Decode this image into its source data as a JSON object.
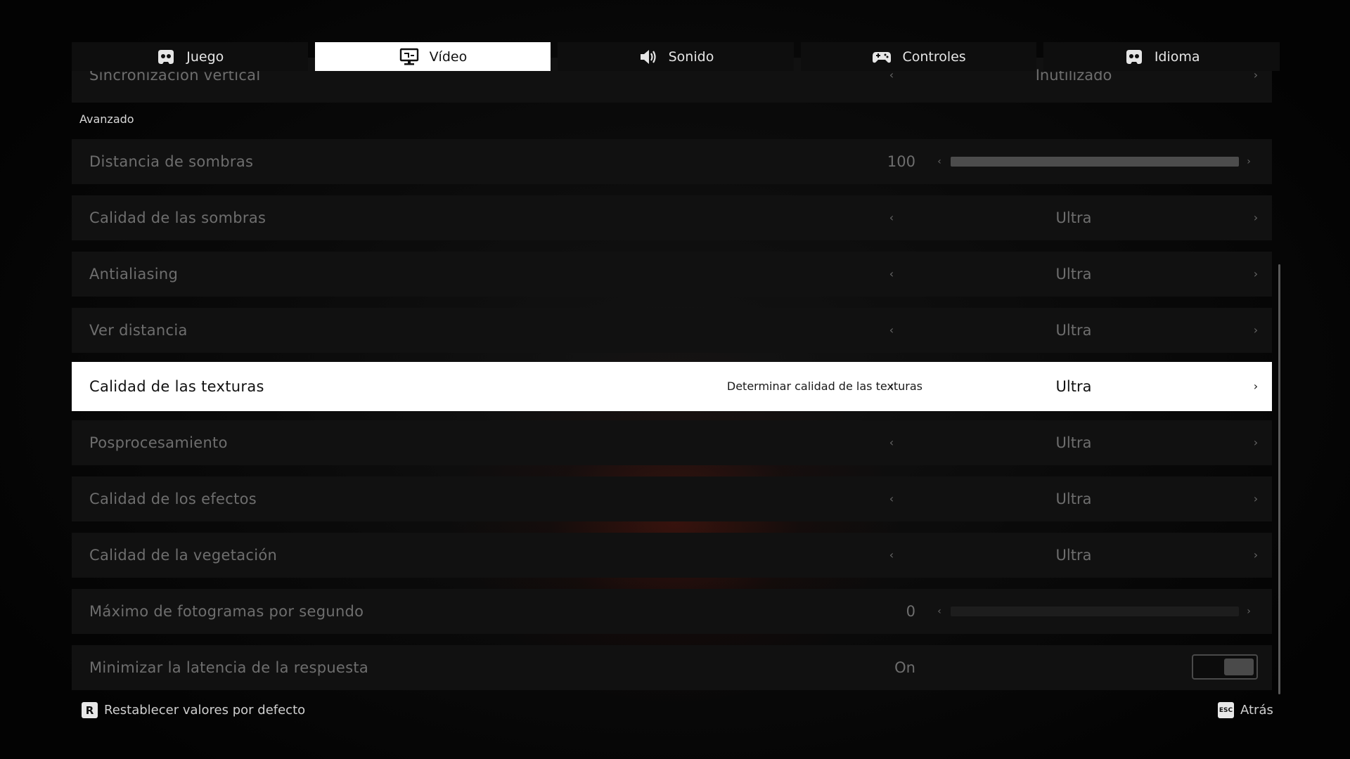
{
  "tabs": [
    {
      "label": "Juego",
      "icon": "gamepad-logo-icon",
      "active": false
    },
    {
      "label": "Vídeo",
      "icon": "monitor-icon",
      "active": true
    },
    {
      "label": "Sonido",
      "icon": "speaker-icon",
      "active": false
    },
    {
      "label": "Controles",
      "icon": "controller-icon",
      "active": false
    },
    {
      "label": "Idioma",
      "icon": "gamepad-logo-icon",
      "active": false
    }
  ],
  "top_partial_row": {
    "label": "Sincronización vertical",
    "value": "Inutilizado"
  },
  "section_title": "Avanzado",
  "rows": [
    {
      "label": "Distancia de sombras",
      "type": "slider",
      "value": "100",
      "fill_fraction": 1.0
    },
    {
      "label": "Calidad de las sombras",
      "type": "select",
      "value": "Ultra"
    },
    {
      "label": "Antialiasing",
      "type": "select",
      "value": "Ultra"
    },
    {
      "label": "Ver distancia",
      "type": "select",
      "value": "Ultra"
    },
    {
      "label": "Calidad de las texturas",
      "type": "select",
      "value": "Ultra",
      "description": "Determinar calidad de las texturas",
      "selected": true
    },
    {
      "label": "Posprocesamiento",
      "type": "select",
      "value": "Ultra"
    },
    {
      "label": "Calidad de los efectos",
      "type": "select",
      "value": "Ultra"
    },
    {
      "label": "Calidad de la vegetación",
      "type": "select",
      "value": "Ultra"
    },
    {
      "label": "Máximo de fotogramas por segundo",
      "type": "slider",
      "value": "0",
      "fill_fraction": 0.0
    },
    {
      "label": "Minimizar la latencia de la respuesta",
      "type": "toggle",
      "value": "On"
    }
  ],
  "footer": {
    "reset": {
      "key": "R",
      "label": "Restablecer valores por defecto"
    },
    "back": {
      "key": "ESC",
      "label": "Atrás"
    }
  },
  "colors": {
    "highlight": "#ffffff",
    "row_bg": "#111111",
    "text_dim": "#6e6e6e"
  }
}
